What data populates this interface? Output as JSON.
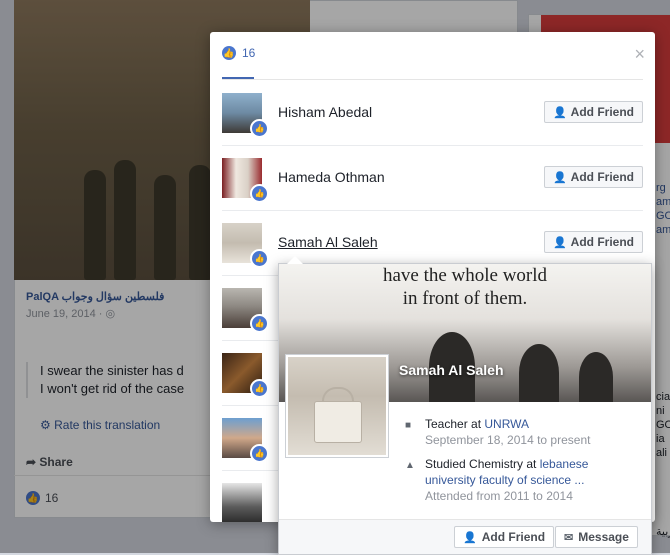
{
  "feed": {
    "page_name": "PalQA فلسطين سؤال وجواب",
    "date": "June 19, 2014 · ◎",
    "quote_lines": [
      "I swear the sinister has d",
      "I won't get rid of the case"
    ],
    "translate": "Rate this translation",
    "share": "Share",
    "likes": "16",
    "right_frags": [
      "rg",
      "ami",
      "GO",
      "ami",
      "cial",
      "ni",
      "GO",
      "ia",
      "ali",
      "عربية"
    ]
  },
  "dialog": {
    "tab_count": "16",
    "close": "×",
    "add_friend": "Add Friend",
    "people": [
      {
        "name": "Hisham Abedal"
      },
      {
        "name": "Hameda Othman"
      },
      {
        "name": "Samah Al Saleh"
      },
      {
        "name": ""
      },
      {
        "name": ""
      },
      {
        "name": ""
      },
      {
        "name": ""
      }
    ]
  },
  "hovercard": {
    "cover_quote": [
      "have the whole world",
      "in front of them."
    ],
    "name": "Samah Al Saleh",
    "work_prefix": "Teacher at ",
    "work_org": "UNRWA",
    "work_date": "September 18, 2014 to present",
    "edu_prefix": "Studied Chemistry at ",
    "edu_org": "lebanese university faculty of science ...",
    "edu_date": "Attended from 2011 to 2014",
    "add_friend": "Add Friend",
    "message": "Message"
  },
  "colors": {
    "accent": "#4267b2",
    "link": "#365899",
    "like": "#4a76ce"
  }
}
